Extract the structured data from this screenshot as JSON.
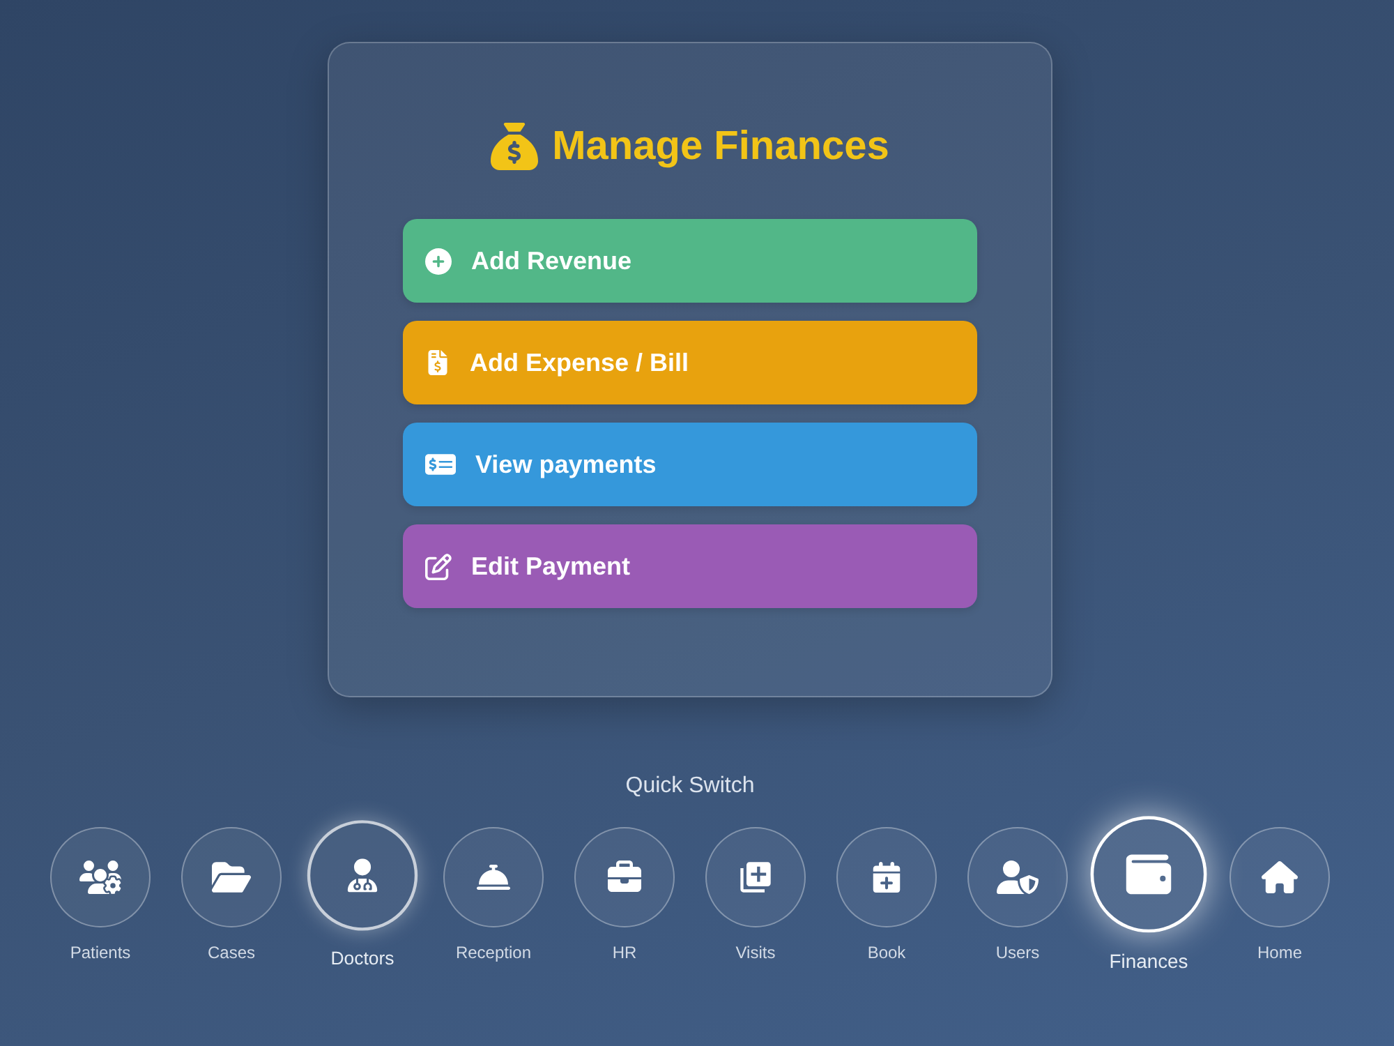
{
  "card": {
    "title": "Manage Finances",
    "actions": [
      {
        "label": "Add Revenue",
        "color": "#52b788"
      },
      {
        "label": "Add Expense / Bill",
        "color": "#e8a20e"
      },
      {
        "label": "View payments",
        "color": "#3598db"
      },
      {
        "label": "Edit Payment",
        "color": "#9a5bb5"
      }
    ]
  },
  "quick_switch": {
    "title": "Quick Switch",
    "items": [
      {
        "label": "Patients",
        "selected": false,
        "hovered": false
      },
      {
        "label": "Cases",
        "selected": false,
        "hovered": false
      },
      {
        "label": "Doctors",
        "selected": false,
        "hovered": true
      },
      {
        "label": "Reception",
        "selected": false,
        "hovered": false
      },
      {
        "label": "HR",
        "selected": false,
        "hovered": false
      },
      {
        "label": "Visits",
        "selected": false,
        "hovered": false
      },
      {
        "label": "Book",
        "selected": false,
        "hovered": false
      },
      {
        "label": "Users",
        "selected": false,
        "hovered": false
      },
      {
        "label": "Finances",
        "selected": true,
        "hovered": false
      },
      {
        "label": "Home",
        "selected": false,
        "hovered": false
      }
    ]
  }
}
